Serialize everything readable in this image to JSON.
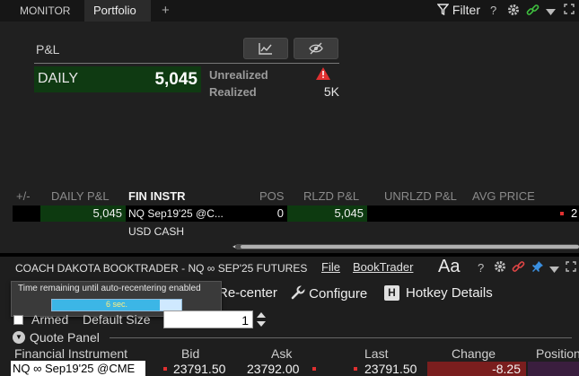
{
  "portfolio_window": {
    "tabs": [
      {
        "label": "MONITOR"
      },
      {
        "label": "Portfolio"
      }
    ],
    "add_tab_glyph": "+",
    "filter_label": "Filter",
    "help_glyph": "?",
    "icons": [
      "filter-icon",
      "gear-icon",
      "link-icon",
      "chevron-down-icon",
      "maximize-icon",
      "line-chart-icon",
      "eye-off-icon",
      "warning-icon"
    ],
    "pnl": {
      "title": "P&L",
      "daily_label": "DAILY",
      "daily_value": "5,045",
      "unrealized_label": "Unrealized",
      "realized_label": "Realized",
      "realized_value": "5K"
    },
    "grid": {
      "columns": [
        "+/-",
        "DAILY P&L",
        "FIN INSTR",
        "POS",
        "RLZD P&L",
        "UNRLZD P&L",
        "AVG PRICE"
      ],
      "rows": [
        {
          "daily_pnl": "5,045",
          "fin_instr": "NQ Sep19'25 @C...",
          "pos": "0",
          "rlzd_pnl": "5,045",
          "avg_price": "2"
        },
        {
          "fin_instr": "USD CASH"
        }
      ]
    },
    "colors": {
      "green": "#0f3a12",
      "warning": "#e03030"
    }
  },
  "booktrader_window": {
    "title": "COACH DAKOTA BOOKTRADER - NQ ∞ SEP'25 FUTURES",
    "menu_file": "File",
    "menu_booktrader": "BookTrader",
    "font_size_glyph": "Aa",
    "help_glyph": "?",
    "tooltip_text": "Time remaining until auto-recentering enabled",
    "progress_text": "6 sec.",
    "progress_fraction": 0.83,
    "toolbar": {
      "recenter_label": "Re-center",
      "configure_label": "Configure",
      "hotkey_label": "Hotkey Details",
      "hotkey_icon_letter": "H"
    },
    "armed_label": "Armed",
    "default_size_label": "Default Size",
    "default_size_value": "1",
    "quote_panel_label": "Quote Panel",
    "quote_columns": [
      "Financial Instrument",
      "Bid",
      "Ask",
      "Last",
      "Change",
      "Position"
    ],
    "quote_row": {
      "instrument": "NQ ∞ Sep19'25 @CME",
      "bid": "23791.50",
      "ask": "23792.00",
      "last": "23791.50",
      "change": "-8.25"
    }
  }
}
